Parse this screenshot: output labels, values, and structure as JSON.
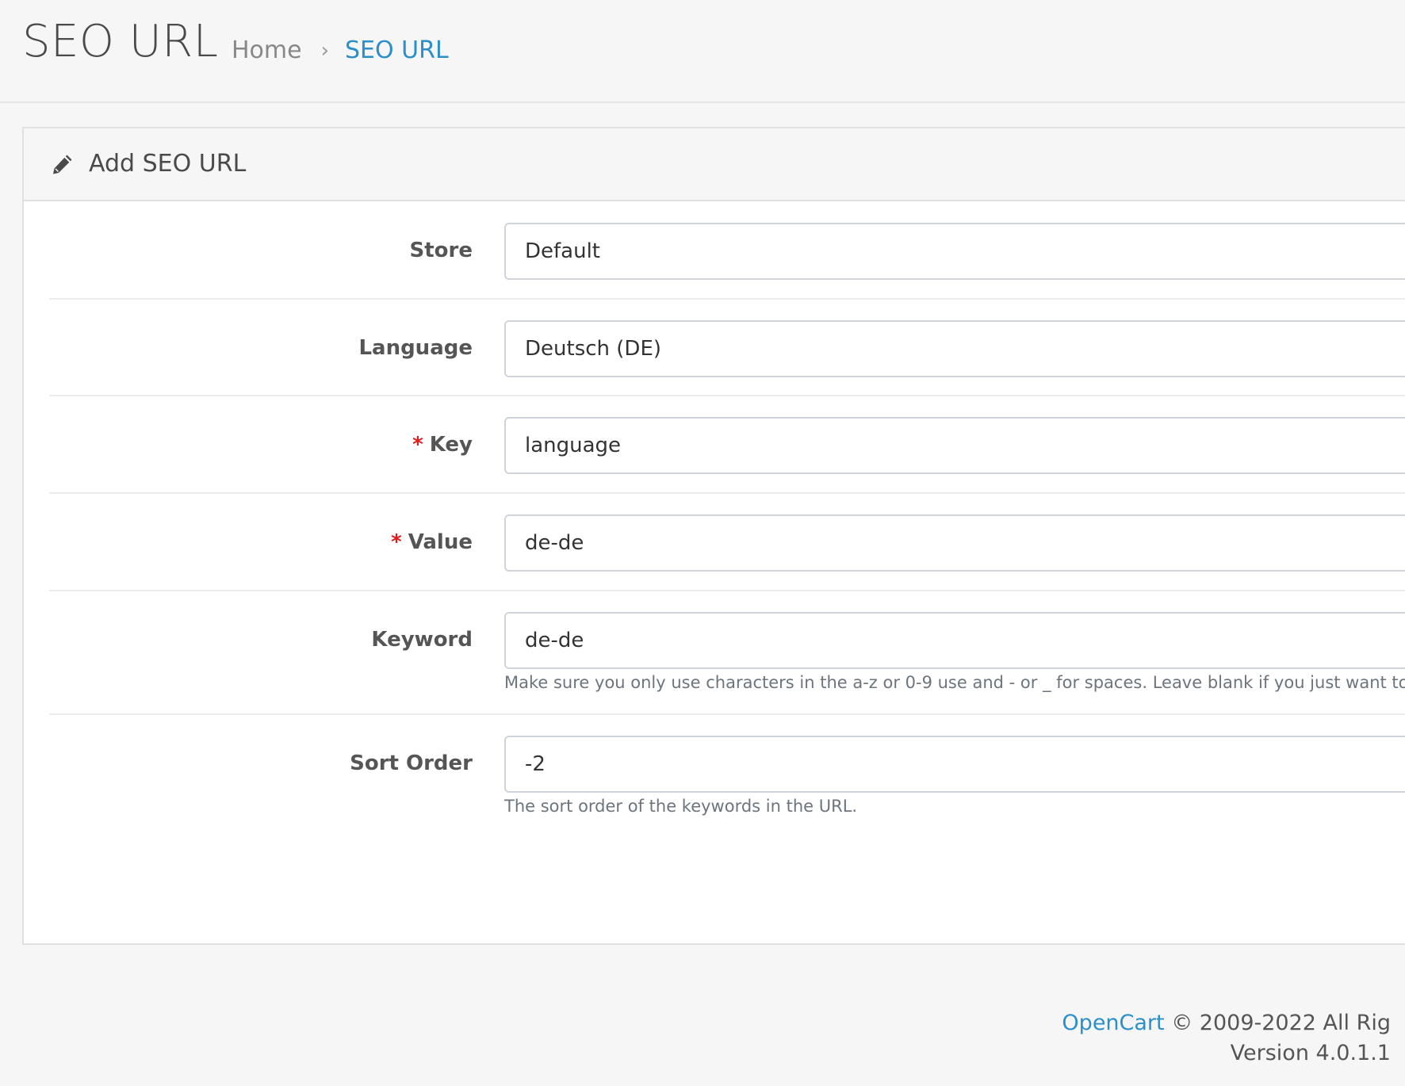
{
  "header": {
    "title": "SEO URL",
    "breadcrumb": {
      "home": "Home",
      "separator": "›",
      "current": "SEO URL"
    }
  },
  "card": {
    "icon": "pencil-icon",
    "title": "Add SEO URL"
  },
  "form": {
    "store": {
      "label": "Store",
      "value": "Default"
    },
    "language": {
      "label": "Language",
      "value": "Deutsch (DE)"
    },
    "key": {
      "label": "Key",
      "required_mark": "*",
      "value": "language"
    },
    "value": {
      "label": "Value",
      "required_mark": "*",
      "value": "de-de"
    },
    "keyword": {
      "label": "Keyword",
      "value": "de-de",
      "help": "Make sure you only use characters in the a-z or 0-9 use and - or _ for spaces. Leave blank if you just want to remov"
    },
    "sort_order": {
      "label": "Sort Order",
      "value": "-2",
      "help": "The sort order of the keywords in the URL."
    }
  },
  "footer": {
    "link": "OpenCart",
    "copyright": " © 2009-2022 All Rig",
    "version": "Version 4.0.1.1"
  },
  "colors": {
    "accent": "#2a8fca",
    "required": "#e31b1b"
  }
}
